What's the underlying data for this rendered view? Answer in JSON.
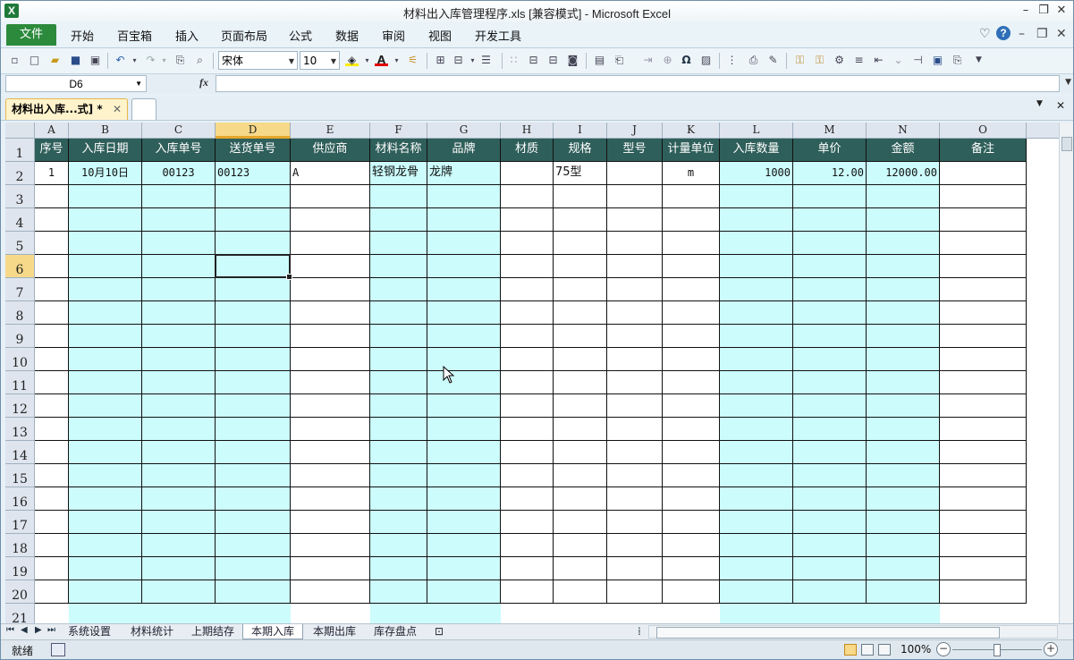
{
  "window": {
    "title": "材料出入库管理程序.xls  [兼容模式] - Microsoft Excel",
    "app_icon": "X"
  },
  "ribbon": {
    "tabs": [
      "文件",
      "开始",
      "百宝箱",
      "插入",
      "页面布局",
      "公式",
      "数据",
      "审阅",
      "视图",
      "开发工具"
    ]
  },
  "toolbar": {
    "font_name": "宋体",
    "font_size": "10"
  },
  "formula_bar": {
    "name_box": "D6",
    "fx_label": "fx",
    "formula": ""
  },
  "workbook_tabs": {
    "active": "材料出入库...式] *",
    "close": "✕"
  },
  "columns": [
    "A",
    "B",
    "C",
    "D",
    "E",
    "F",
    "G",
    "H",
    "I",
    "J",
    "K",
    "L",
    "M",
    "N",
    "O"
  ],
  "rows": [
    "1",
    "2",
    "3",
    "4",
    "5",
    "6",
    "7",
    "8",
    "9",
    "10",
    "11",
    "12",
    "13",
    "14",
    "15",
    "16",
    "17",
    "18",
    "19",
    "20",
    "21"
  ],
  "table": {
    "headers": [
      "序号",
      "入库日期",
      "入库单号",
      "送货单号",
      "供应商",
      "材料名称",
      "品牌",
      "材质",
      "规格",
      "型号",
      "计量单位",
      "入库数量",
      "单价",
      "金额",
      "备注"
    ],
    "data_row": [
      "1",
      "10月10日",
      "00123",
      "00123",
      "A",
      "轻钢龙骨",
      "龙牌",
      "",
      "75型",
      "",
      "m",
      "1000",
      "12.00",
      "12000.00",
      ""
    ]
  },
  "sheet_tabs": [
    "系统设置",
    "材料统计",
    "上期结存",
    "本期入库",
    "本期出库",
    "库存盘点"
  ],
  "active_sheet": "本期入库",
  "status": {
    "ready": "就绪",
    "zoom": "100%"
  },
  "colors": {
    "header_fill": "#2f5f5a",
    "input_fill": "#ccfcfc",
    "file_tab": "#2c8a3c"
  }
}
